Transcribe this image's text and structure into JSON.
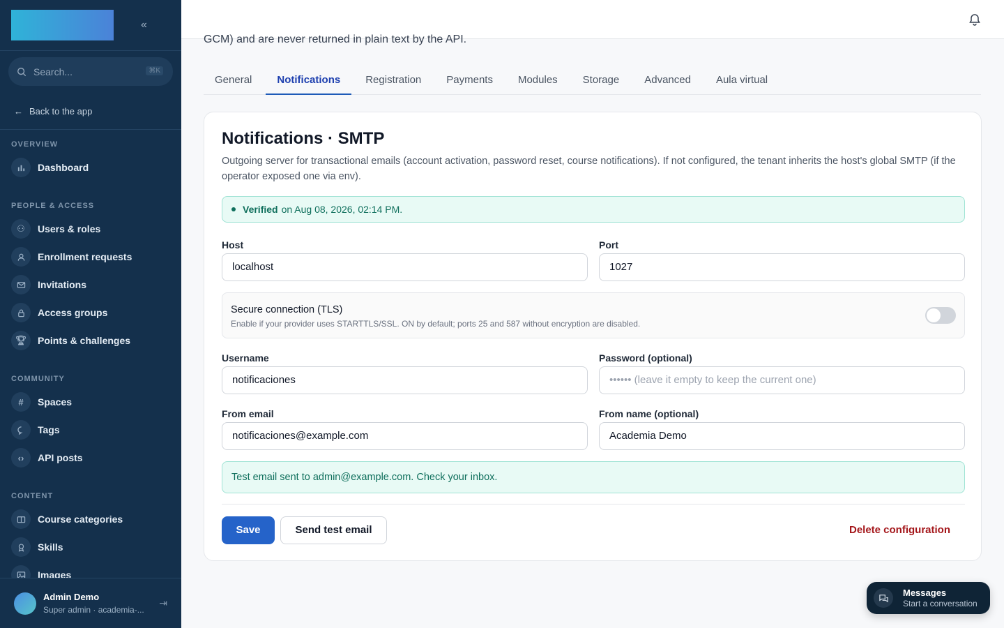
{
  "sidebar": {
    "collapse_glyph": "«",
    "search_placeholder": "Search...",
    "search_shortcut": "⌘K",
    "back_label": "Back to the app",
    "sections": {
      "overview": {
        "title": "OVERVIEW",
        "items": [
          "Dashboard"
        ]
      },
      "people": {
        "title": "PEOPLE & ACCESS",
        "items": [
          "Users & roles",
          "Enrollment requests",
          "Invitations",
          "Access groups",
          "Points & challenges"
        ]
      },
      "community": {
        "title": "COMMUNITY",
        "items": [
          "Spaces",
          "Tags",
          "API posts"
        ]
      },
      "content": {
        "title": "CONTENT",
        "items": [
          "Course categories",
          "Skills",
          "Images"
        ]
      }
    },
    "user": {
      "name": "Admin Demo",
      "role": "Super admin · academia-..."
    }
  },
  "intro_text": "GCM) and are never returned in plain text by the API.",
  "tabs": [
    "General",
    "Notifications",
    "Registration",
    "Payments",
    "Modules",
    "Storage",
    "Advanced",
    "Aula virtual"
  ],
  "card": {
    "title": "Notifications · SMTP",
    "description": "Outgoing server for transactional emails (account activation, password reset, course notifications). If not configured, the tenant inherits the host's global SMTP (if the operator exposed one via env).",
    "verified_label": "Verified",
    "verified_rest": "on Aug 08, 2026, 02:14 PM.",
    "host_label": "Host",
    "host_value": "localhost",
    "port_label": "Port",
    "port_value": "1027",
    "tls_title": "Secure connection (TLS)",
    "tls_desc": "Enable if your provider uses STARTTLS/SSL. ON by default; ports 25 and 587 without encryption are disabled.",
    "tls_enabled": false,
    "username_label": "Username",
    "username_value": "notificaciones",
    "password_label": "Password (optional)",
    "password_placeholder": "•••••• (leave it empty to keep the current one)",
    "from_email_label": "From email",
    "from_email_value": "notificaciones@example.com",
    "from_name_label": "From name (optional)",
    "from_name_value": "Academia Demo",
    "success_msg": "Test email sent to admin@example.com. Check your inbox.",
    "save_label": "Save",
    "test_label": "Send test email",
    "delete_label": "Delete configuration"
  },
  "messages": {
    "title": "Messages",
    "subtitle": "Start a conversation"
  },
  "colors": {
    "sidebar_bg": "#14304c",
    "primary": "#2563c9",
    "success_bg": "#e8faf5",
    "danger": "#a4161a"
  }
}
